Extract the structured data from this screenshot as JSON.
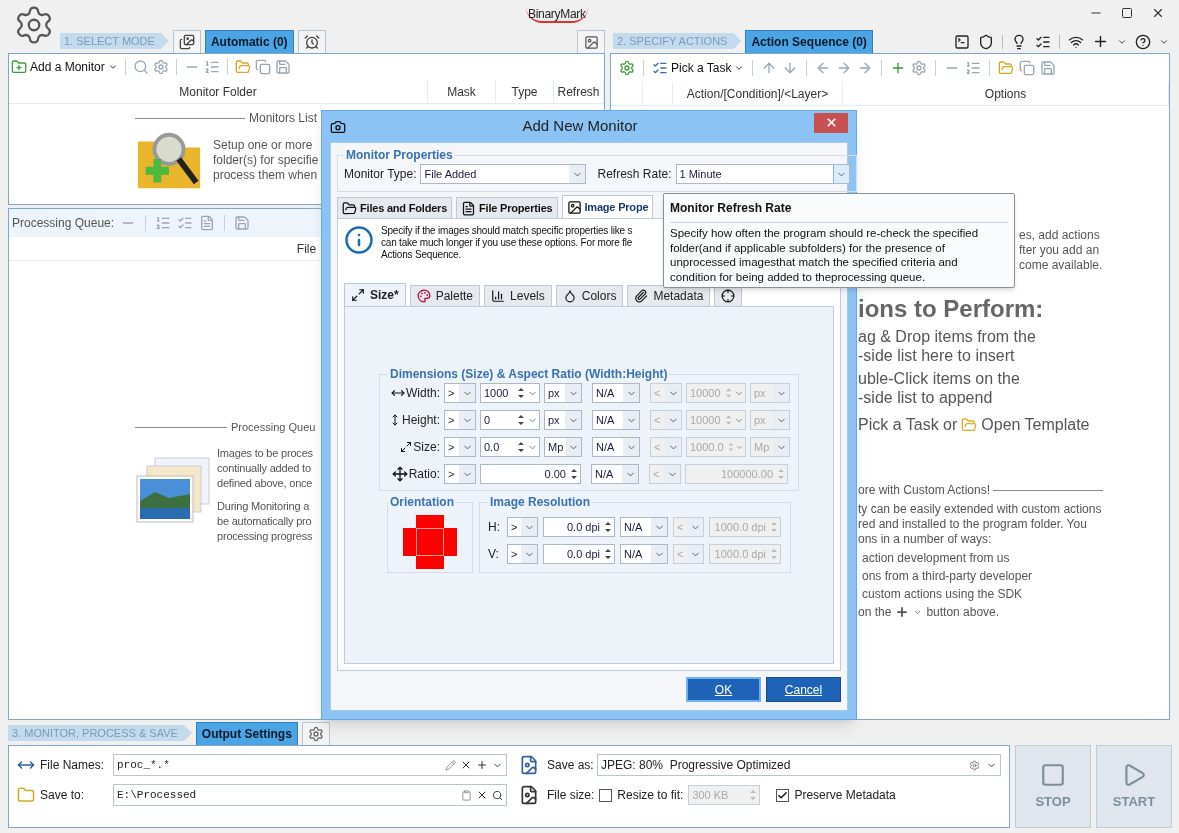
{
  "app": {
    "logo": "BinaryMark"
  },
  "select_mode": {
    "step": "1. SELECT MODE",
    "tabs": [
      {
        "kind": "gallery",
        "selected": false
      },
      {
        "kind": "text",
        "label": "Automatic (0)",
        "selected": true
      },
      {
        "kind": "alarm",
        "selected": false
      }
    ]
  },
  "monitors": {
    "add_label": "Add a Monitor",
    "columns": [
      "Monitor Folder",
      "Mask",
      "Type",
      "Refresh"
    ],
    "empty": {
      "title": "Monitors List",
      "lines": [
        "Setup one or more",
        "folder(s) for specifie",
        "process them when"
      ]
    }
  },
  "queue": {
    "label": "Processing Queue:",
    "columns": [
      "File"
    ],
    "empty": {
      "title": "Processing Queu",
      "paragraphs": [
        [
          "Images to be proces",
          "continually added to",
          "defined above, once"
        ],
        [
          "During Monitoring a",
          "be automatically pro",
          "processing progress"
        ]
      ]
    }
  },
  "actions": {
    "step": "2. SPECIFY ACTIONS",
    "tabs": [
      {
        "label": "Action Sequence (0)",
        "selected": true
      }
    ],
    "pick_label": "Pick a Task",
    "columns": [
      "Action/[Condition]/<Layer>",
      "Options"
    ],
    "help": {
      "intro": [
        "es, add actions",
        "fter you add an",
        "come available."
      ],
      "heading": "ions to Perform:",
      "steps": [
        [
          "ag & Drop items from the",
          "-side list here to insert"
        ],
        [
          "uble-Click items on the",
          "-side list to append"
        ]
      ],
      "last_step": {
        "before": "Pick a Task or",
        "link": "Open Template"
      },
      "custom_title": "ore with Custom Actions!",
      "custom_lines": [
        "ty can be easily extended with custom actions",
        "red and installed to the program folder. You",
        "ons in a number of ways:"
      ],
      "ways": [
        "action development from us",
        "ons from a third-party developer",
        "custom actions using the SDK"
      ],
      "footer": {
        "before": "on the",
        "after": "button above."
      }
    }
  },
  "output": {
    "step": "3. MONITOR, PROCESS & SAVE",
    "tabs": [
      {
        "kind": "text",
        "label": "Output Settings",
        "selected": true
      },
      {
        "kind": "gear",
        "selected": false
      }
    ],
    "file_names": {
      "label": "File Names:",
      "value": "proc_*.*"
    },
    "save_to": {
      "label": "Save to:",
      "value": "E:\\Processed"
    },
    "save_as": {
      "label": "Save as:",
      "value": "JPEG: 80%  Progressive Optimized"
    },
    "file_size": {
      "label": "File size:",
      "resize": {
        "label": "Resize to fit:",
        "checked": false,
        "value": "300 KB",
        "disabled": true
      },
      "preserve": {
        "label": "Preserve Metadata",
        "checked": true
      }
    },
    "buttons": [
      {
        "kind": "stop",
        "label": "STOP",
        "disabled": true
      },
      {
        "kind": "start",
        "label": "START",
        "disabled": true
      }
    ]
  },
  "dialog": {
    "title": "Add New Monitor",
    "properties": {
      "title": "Monitor Properties",
      "type_label": "Monitor Type:",
      "type_value": "File Added",
      "rate_label": "Refresh Rate:",
      "rate_value": "1 Minute"
    },
    "tabs": [
      {
        "kind": "folders",
        "label": "Files and Folders",
        "selected": false
      },
      {
        "kind": "file",
        "label": "File Properties",
        "selected": false
      },
      {
        "kind": "image",
        "label": "Image Prope",
        "selected": true
      }
    ],
    "info": [
      "Specify if the images should match specific properties like s",
      "can take much longer if you use these options. For more fle",
      "Actions Sequence."
    ],
    "inner_tabs": [
      {
        "kind": "size",
        "label": "Size*",
        "selected": true
      },
      {
        "kind": "palette",
        "label": "Palette",
        "selected": false
      },
      {
        "kind": "levels",
        "label": "Levels",
        "selected": false
      },
      {
        "kind": "colors",
        "label": "Colors",
        "selected": false
      },
      {
        "kind": "metadata",
        "label": "Metadata",
        "selected": false
      },
      {
        "kind": "pointer",
        "selected": false
      }
    ],
    "dimensions": {
      "title": "Dimensions (Size) & Aspect Ratio (Width:Height)",
      "rows": [
        {
          "kind": "width",
          "label": "Width:",
          "op": ">",
          "value": "1000",
          "unit": "px",
          "cond": "N/A",
          "op2": "<",
          "max": "10000",
          "unit2": "px",
          "max_disabled": true
        },
        {
          "kind": "height",
          "label": "Height:",
          "op": ">",
          "value": "0",
          "unit": "px",
          "cond": "N/A",
          "op2": "<",
          "max": "10000",
          "unit2": "px",
          "max_disabled": true
        },
        {
          "kind": "size",
          "label": "Size:",
          "op": ">",
          "value": "0.0",
          "unit": "Mp",
          "cond": "N/A",
          "op2": "<",
          "max": "1000.0",
          "unit2": "Mp",
          "max_disabled": true
        },
        {
          "kind": "ratio",
          "label": "Ratio:",
          "op": ">",
          "value": "0.00",
          "cond": "N/A",
          "op2": "<",
          "max": "100000.00",
          "max_disabled": true
        }
      ]
    },
    "orientation": {
      "title": "Orientation"
    },
    "resolution": {
      "title": "Image Resolution",
      "rows": [
        {
          "label": "H:",
          "op": ">",
          "value": "0.0 dpi",
          "cond": "N/A",
          "op2": "<",
          "max": "1000.0 dpi",
          "max_disabled": true
        },
        {
          "label": "V:",
          "op": ">",
          "value": "0.0 dpi",
          "cond": "N/A",
          "op2": "<",
          "max": "1000.0 dpi",
          "max_disabled": true
        }
      ]
    },
    "buttons": [
      {
        "label": "OK",
        "kind": "primary"
      },
      {
        "label": "Cancel",
        "kind": "secondary"
      }
    ]
  },
  "tooltip": {
    "title": "Monitor Refresh Rate",
    "lines": [
      "Specify how often the program should re-check the specified",
      "folder(and if applicable subfolders) for the presence of",
      "unprocessed imagesthat match the specified criteria and",
      "condition for being added to theprocessing queue."
    ]
  }
}
